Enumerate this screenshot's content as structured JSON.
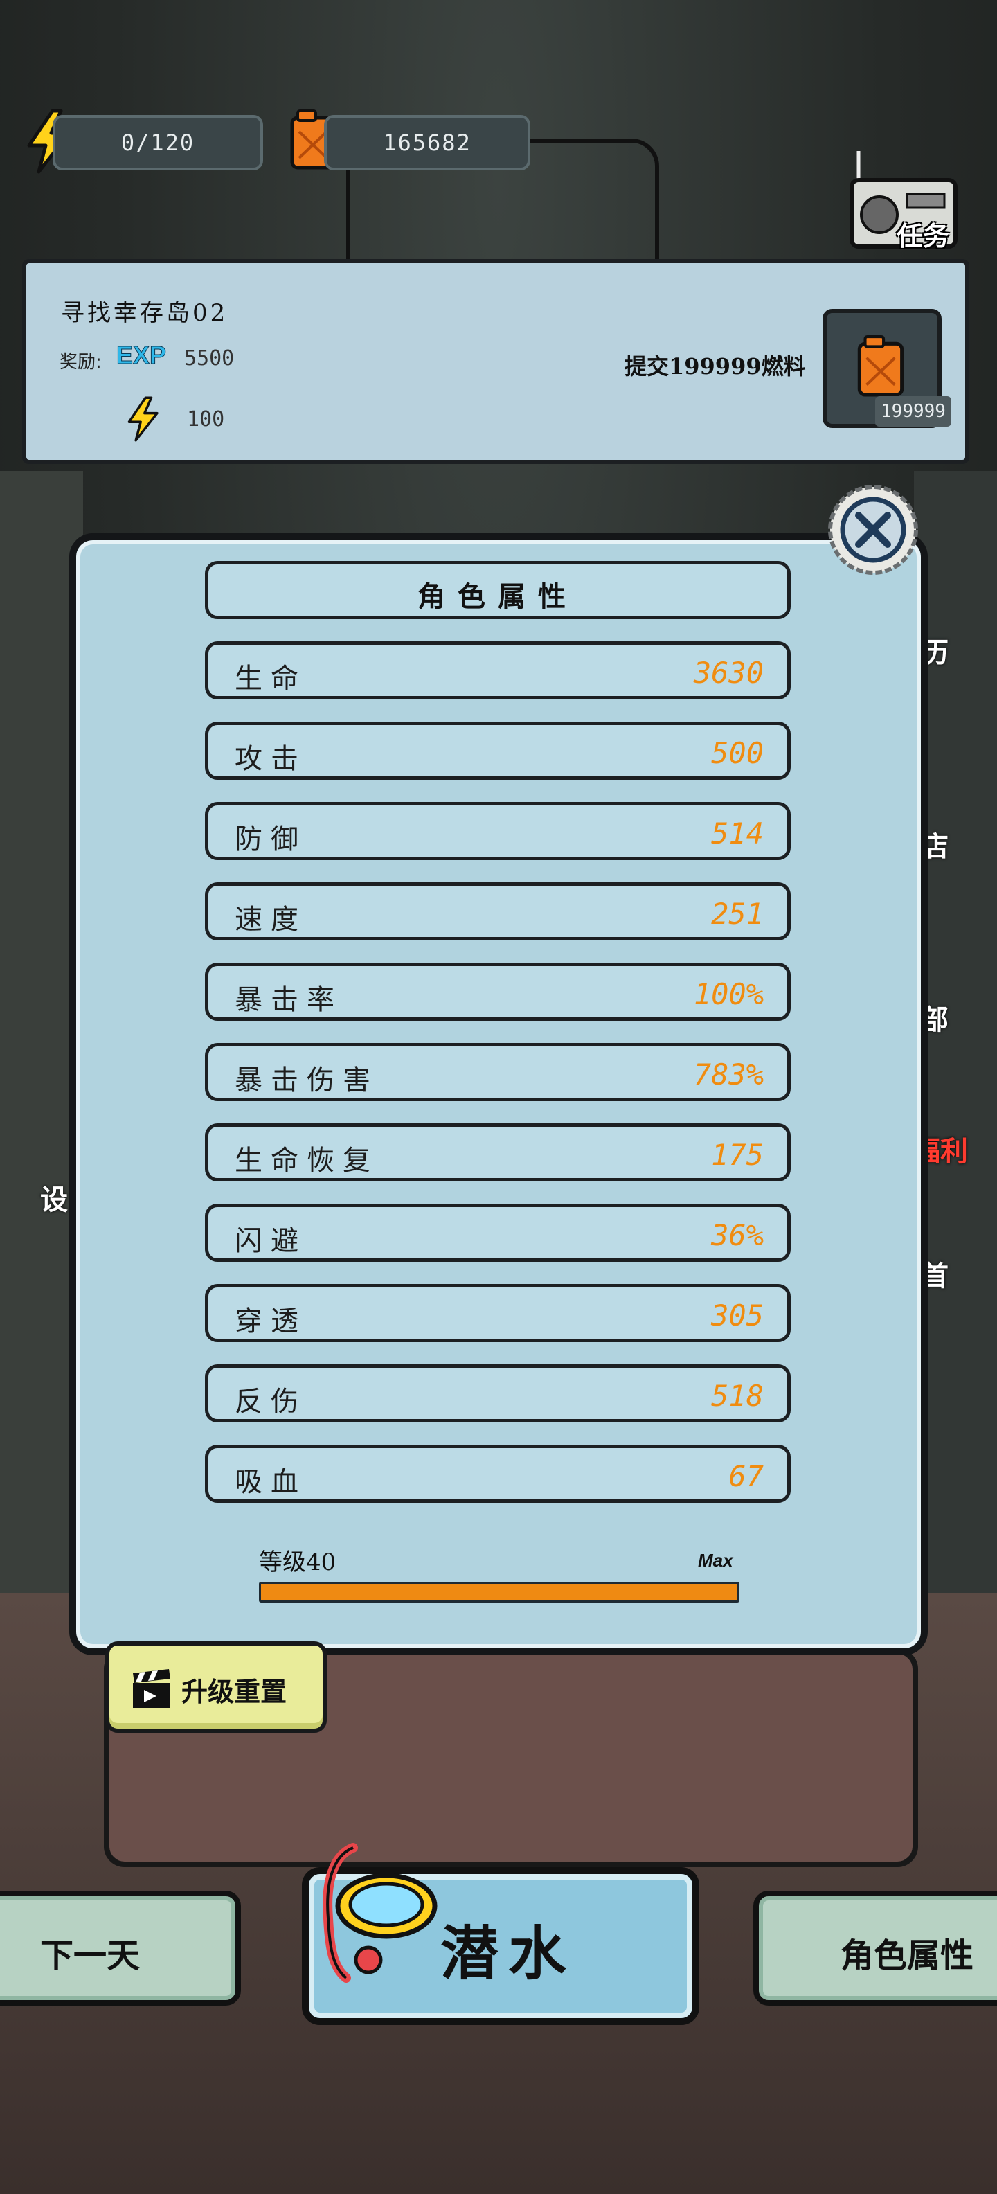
{
  "top_bar": {
    "energy": "0/120",
    "fuel": "165682",
    "task_label": "任务"
  },
  "quest": {
    "title": "寻找幸存岛02",
    "reward_label": "奖励:",
    "exp_badge": "EXP",
    "exp_value": "5500",
    "energy_value": "100",
    "submit_text": "提交199999燃料",
    "slot_count": "199999"
  },
  "attributes": {
    "title": "角色属性",
    "stats": [
      {
        "name": "生命",
        "value": "3630"
      },
      {
        "name": "攻击",
        "value": "500"
      },
      {
        "name": "防御",
        "value": "514"
      },
      {
        "name": "速度",
        "value": "251"
      },
      {
        "name": "暴击率",
        "value": "100%"
      },
      {
        "name": "暴击伤害",
        "value": "783%"
      },
      {
        "name": "生命恢复",
        "value": "175"
      },
      {
        "name": "闪避",
        "value": "36%"
      },
      {
        "name": "穿透",
        "value": "305"
      },
      {
        "name": "反伤",
        "value": "518"
      },
      {
        "name": "吸血",
        "value": "67"
      }
    ],
    "level_label": "等级40",
    "level_max": "Max",
    "level_progress": 1.0
  },
  "reset_button": "升级重置",
  "background_labels": {
    "right_1": "历",
    "right_2": "店",
    "right_3": "部",
    "right_4": "福利",
    "right_5": "首",
    "left_1": "设"
  },
  "nav": {
    "next_day": "下一天",
    "dive": "潜水",
    "attributes": "角色属性"
  },
  "colors": {
    "accent_orange": "#f08c10",
    "panel_blue": "#b1d3df",
    "reset_yellow": "#e9ec9a"
  }
}
